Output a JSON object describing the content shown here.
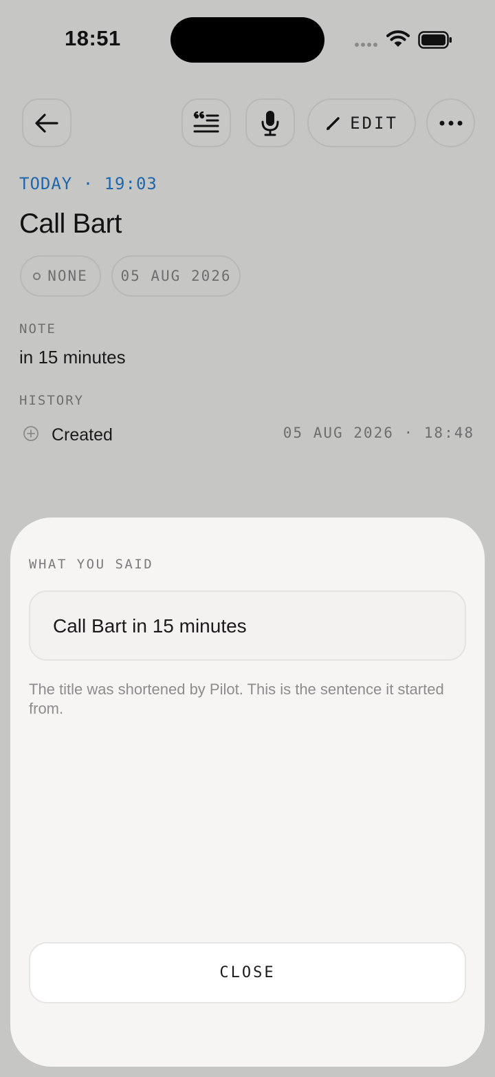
{
  "status_bar": {
    "time": "18:51",
    "wifi_icon": "wifi-icon",
    "battery_icon": "battery-icon"
  },
  "toolbar": {
    "back_icon": "arrow-left-icon",
    "quote_icon": "quote-lines-icon",
    "mic_icon": "microphone-icon",
    "edit_icon": "pencil-icon",
    "edit_label": "EDIT",
    "more_icon": "ellipsis-icon"
  },
  "reminder": {
    "when": "TODAY · 19:03",
    "title": "Call Bart",
    "chips": {
      "priority": "NONE",
      "date": "05 AUG 2026"
    },
    "note_label": "NOTE",
    "note": "in 15 minutes",
    "history_label": "HISTORY",
    "history": [
      {
        "icon": "plus-circle-icon",
        "event": "Created",
        "time": "05 AUG 2026 · 18:48"
      }
    ]
  },
  "sheet": {
    "label": "WHAT YOU SAID",
    "said": "Call Bart in 15 minutes",
    "help": "The title was shortened by Pilot. This is the sentence it started from.",
    "close_label": "CLOSE"
  },
  "colors": {
    "accent": "#1f66ad",
    "background": "#c6c6c4",
    "sheet": "#f6f5f3"
  }
}
